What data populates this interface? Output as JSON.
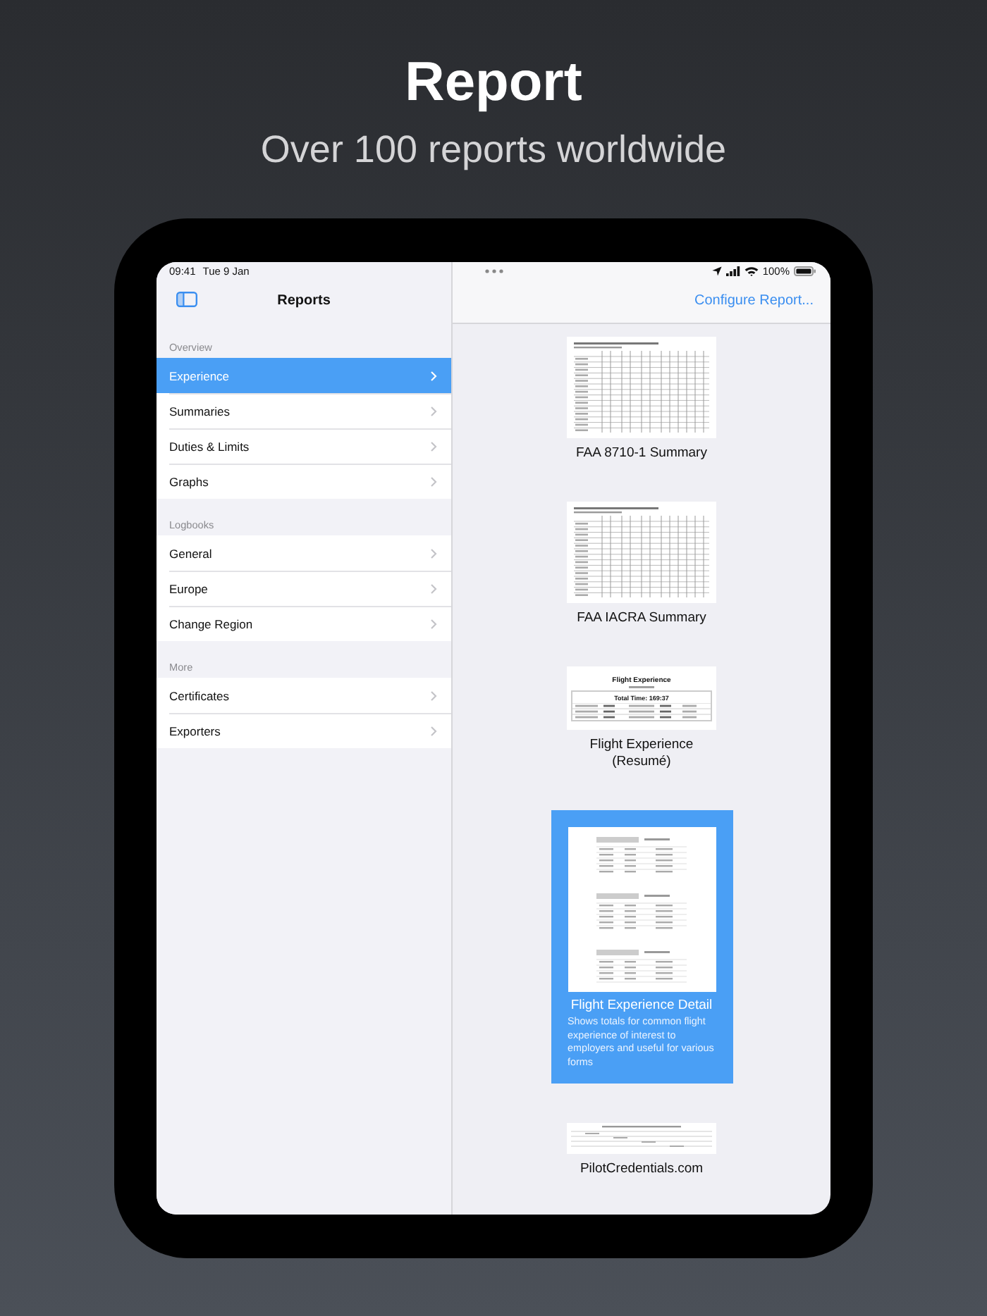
{
  "headline": {
    "title": "Report",
    "subtitle": "Over 100 reports worldwide"
  },
  "status_bar": {
    "time": "09:41",
    "date": "Tue 9 Jan",
    "battery": "100%"
  },
  "sidebar": {
    "title": "Reports",
    "sections": [
      {
        "header": "Overview",
        "items": [
          {
            "label": "Experience",
            "selected": true
          },
          {
            "label": "Summaries",
            "selected": false
          },
          {
            "label": "Duties & Limits",
            "selected": false
          },
          {
            "label": "Graphs",
            "selected": false
          }
        ]
      },
      {
        "header": "Logbooks",
        "items": [
          {
            "label": "General",
            "selected": false
          },
          {
            "label": "Europe",
            "selected": false
          },
          {
            "label": "Change Region",
            "selected": false
          }
        ]
      },
      {
        "header": "More",
        "items": [
          {
            "label": "Certificates",
            "selected": false
          },
          {
            "label": "Exporters",
            "selected": false
          }
        ]
      }
    ]
  },
  "toolbar": {
    "action": "Configure Report..."
  },
  "reports": [
    {
      "title": "FAA 8710-1 Summary",
      "selected": false,
      "thumbnail": {
        "kind": "table"
      }
    },
    {
      "title": "FAA IACRA Summary",
      "selected": false,
      "thumbnail": {
        "kind": "table"
      }
    },
    {
      "title": "Flight Experience (Resumé)",
      "selected": false,
      "thumbnail": {
        "kind": "resume",
        "heading": "Flight Experience",
        "total": "Total Time: 169:37"
      }
    },
    {
      "title": "Flight Experience Detail",
      "description": "Shows totals for common flight experience of interest to employers and useful for various forms",
      "selected": true,
      "thumbnail": {
        "kind": "detail"
      }
    },
    {
      "title": "PilotCredentials.com",
      "selected": false,
      "thumbnail": {
        "kind": "wide"
      }
    }
  ]
}
